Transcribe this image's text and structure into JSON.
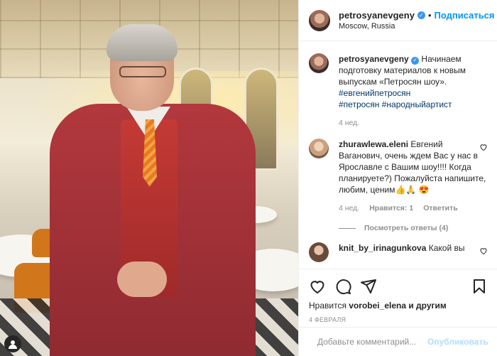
{
  "header": {
    "username": "petrosyanevgeny",
    "separator": "•",
    "follow_label": "Подписаться",
    "location": "Moscow, Russia"
  },
  "caption": {
    "username": "petrosyanevgeny",
    "text": "Начинаем подготовку материалов к новым выпускам «Петросян шоу».",
    "hashtags": [
      "#евгенийпетросян",
      "#петросян #народныйартист"
    ],
    "time": "4 нед."
  },
  "comments": [
    {
      "username": "zhurawlewa.eleni",
      "text": "Евгений Ваганович, очень ждем Вас у нас в Ярославле с Вашим шоу!!!! Когда планируете?) Пожалуйста напишите, любим, ценим👍🙏 😍",
      "time": "4 нед.",
      "likes": "Нравится: 1",
      "reply": "Ответить",
      "view_replies": "Посмотреть ответы (4)"
    },
    {
      "username": "knit_by_irinagunkova",
      "text": "Какой вы"
    }
  ],
  "actions": {
    "liked_by_prefix": "Нравится",
    "liked_by_user": "vorobei_elena",
    "liked_by_suffix": "и другим",
    "date": "4 ФЕВРАЛЯ"
  },
  "add_comment": {
    "placeholder": "Добавьте комментарий...",
    "publish_label": "Опубликовать"
  },
  "icons": {
    "like": "heart-icon",
    "comment": "comment-icon",
    "share": "paper-plane-icon",
    "save": "bookmark-icon",
    "emoji": "smiley-icon",
    "tag": "user-tag-icon",
    "verified": "verified-badge-icon"
  },
  "colors": {
    "link": "#0095f6",
    "hashtag": "#00376b",
    "muted": "#8e8e8e",
    "verified": "#3897f0"
  }
}
